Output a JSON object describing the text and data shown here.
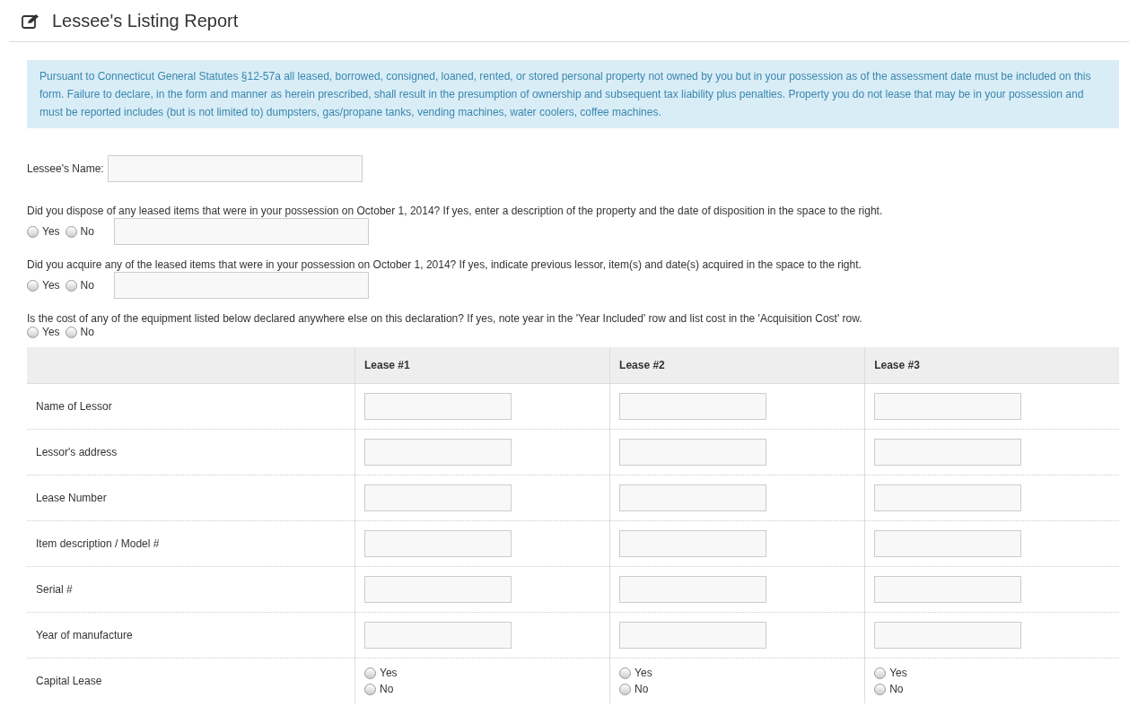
{
  "title": "Lessee's Listing Report",
  "notice": "Pursuant to Connecticut General Statutes §12-57a all leased, borrowed, consigned, loaned, rented, or stored personal property not owned by you but in your possession as of the assessment date must be included on this form. Failure to declare, in the form and manner as herein prescribed, shall result in the presumption of ownership and subsequent tax liability plus penalties. Property you do not lease that may be in your possession and must be reported includes (but is not limited to) dumpsters, gas/propane tanks, vending machines, water coolers, coffee machines.",
  "lessee_name": {
    "label": "Lessee's Name:"
  },
  "questions": [
    {
      "text": "Did you dispose of any leased items that were in your possession on October 1, 2014? If yes, enter a description of the property and the date of disposition in the space to the right.",
      "has_field": true,
      "options": [
        {
          "label": "Yes",
          "selected": false
        },
        {
          "label": "No",
          "selected": false
        }
      ]
    },
    {
      "text": "Did you acquire any of the leased items that were in your possession on October 1, 2014? If yes, indicate previous lessor, item(s) and date(s) acquired in the space to the right.",
      "has_field": true,
      "options": [
        {
          "label": "Yes",
          "selected": false
        },
        {
          "label": "No",
          "selected": false
        }
      ]
    },
    {
      "text": "Is the cost of any of the equipment listed below declared anywhere else on this declaration? If yes, note year in the 'Year Included' row and list cost in the 'Acquisition Cost' row.",
      "has_field": false,
      "options": [
        {
          "label": "Yes",
          "selected": false
        },
        {
          "label": "No",
          "selected": false
        }
      ]
    }
  ],
  "table": {
    "columns": [
      "Lease #1",
      "Lease #2",
      "Lease #3"
    ],
    "rows": [
      {
        "label": "Name of Lessor",
        "kind": "text"
      },
      {
        "label": "Lessor's address",
        "kind": "text"
      },
      {
        "label": "Lease Number",
        "kind": "text"
      },
      {
        "label": "Item description / Model #",
        "kind": "text"
      },
      {
        "label": "Serial #",
        "kind": "text"
      },
      {
        "label": "Year of manufacture",
        "kind": "text"
      },
      {
        "label": "Capital Lease",
        "kind": "radio",
        "cells": [
          {
            "options": [
              {
                "label": "Yes",
                "selected": false
              },
              {
                "label": "No",
                "selected": false
              }
            ]
          },
          {
            "options": [
              {
                "label": "Yes",
                "selected": false
              },
              {
                "label": "No",
                "selected": false
              }
            ]
          },
          {
            "options": [
              {
                "label": "Yes",
                "selected": false
              },
              {
                "label": "No",
                "selected": false
              }
            ]
          }
        ]
      }
    ]
  }
}
